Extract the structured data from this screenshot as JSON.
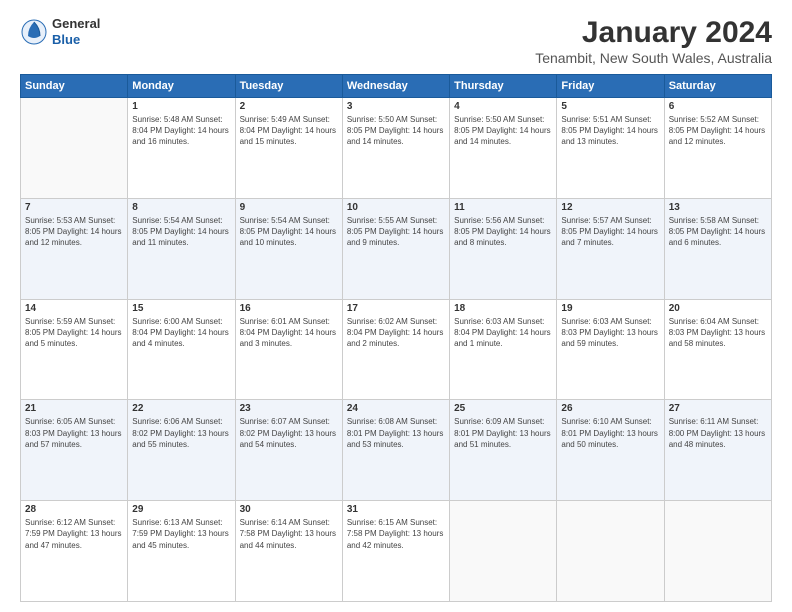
{
  "header": {
    "logo_general": "General",
    "logo_blue": "Blue",
    "title": "January 2024",
    "location": "Tenambit, New South Wales, Australia"
  },
  "weekdays": [
    "Sunday",
    "Monday",
    "Tuesday",
    "Wednesday",
    "Thursday",
    "Friday",
    "Saturday"
  ],
  "weeks": [
    [
      {
        "day": "",
        "info": ""
      },
      {
        "day": "1",
        "info": "Sunrise: 5:48 AM\nSunset: 8:04 PM\nDaylight: 14 hours\nand 16 minutes."
      },
      {
        "day": "2",
        "info": "Sunrise: 5:49 AM\nSunset: 8:04 PM\nDaylight: 14 hours\nand 15 minutes."
      },
      {
        "day": "3",
        "info": "Sunrise: 5:50 AM\nSunset: 8:05 PM\nDaylight: 14 hours\nand 14 minutes."
      },
      {
        "day": "4",
        "info": "Sunrise: 5:50 AM\nSunset: 8:05 PM\nDaylight: 14 hours\nand 14 minutes."
      },
      {
        "day": "5",
        "info": "Sunrise: 5:51 AM\nSunset: 8:05 PM\nDaylight: 14 hours\nand 13 minutes."
      },
      {
        "day": "6",
        "info": "Sunrise: 5:52 AM\nSunset: 8:05 PM\nDaylight: 14 hours\nand 12 minutes."
      }
    ],
    [
      {
        "day": "7",
        "info": "Sunrise: 5:53 AM\nSunset: 8:05 PM\nDaylight: 14 hours\nand 12 minutes."
      },
      {
        "day": "8",
        "info": "Sunrise: 5:54 AM\nSunset: 8:05 PM\nDaylight: 14 hours\nand 11 minutes."
      },
      {
        "day": "9",
        "info": "Sunrise: 5:54 AM\nSunset: 8:05 PM\nDaylight: 14 hours\nand 10 minutes."
      },
      {
        "day": "10",
        "info": "Sunrise: 5:55 AM\nSunset: 8:05 PM\nDaylight: 14 hours\nand 9 minutes."
      },
      {
        "day": "11",
        "info": "Sunrise: 5:56 AM\nSunset: 8:05 PM\nDaylight: 14 hours\nand 8 minutes."
      },
      {
        "day": "12",
        "info": "Sunrise: 5:57 AM\nSunset: 8:05 PM\nDaylight: 14 hours\nand 7 minutes."
      },
      {
        "day": "13",
        "info": "Sunrise: 5:58 AM\nSunset: 8:05 PM\nDaylight: 14 hours\nand 6 minutes."
      }
    ],
    [
      {
        "day": "14",
        "info": "Sunrise: 5:59 AM\nSunset: 8:05 PM\nDaylight: 14 hours\nand 5 minutes."
      },
      {
        "day": "15",
        "info": "Sunrise: 6:00 AM\nSunset: 8:04 PM\nDaylight: 14 hours\nand 4 minutes."
      },
      {
        "day": "16",
        "info": "Sunrise: 6:01 AM\nSunset: 8:04 PM\nDaylight: 14 hours\nand 3 minutes."
      },
      {
        "day": "17",
        "info": "Sunrise: 6:02 AM\nSunset: 8:04 PM\nDaylight: 14 hours\nand 2 minutes."
      },
      {
        "day": "18",
        "info": "Sunrise: 6:03 AM\nSunset: 8:04 PM\nDaylight: 14 hours\nand 1 minute."
      },
      {
        "day": "19",
        "info": "Sunrise: 6:03 AM\nSunset: 8:03 PM\nDaylight: 13 hours\nand 59 minutes."
      },
      {
        "day": "20",
        "info": "Sunrise: 6:04 AM\nSunset: 8:03 PM\nDaylight: 13 hours\nand 58 minutes."
      }
    ],
    [
      {
        "day": "21",
        "info": "Sunrise: 6:05 AM\nSunset: 8:03 PM\nDaylight: 13 hours\nand 57 minutes."
      },
      {
        "day": "22",
        "info": "Sunrise: 6:06 AM\nSunset: 8:02 PM\nDaylight: 13 hours\nand 55 minutes."
      },
      {
        "day": "23",
        "info": "Sunrise: 6:07 AM\nSunset: 8:02 PM\nDaylight: 13 hours\nand 54 minutes."
      },
      {
        "day": "24",
        "info": "Sunrise: 6:08 AM\nSunset: 8:01 PM\nDaylight: 13 hours\nand 53 minutes."
      },
      {
        "day": "25",
        "info": "Sunrise: 6:09 AM\nSunset: 8:01 PM\nDaylight: 13 hours\nand 51 minutes."
      },
      {
        "day": "26",
        "info": "Sunrise: 6:10 AM\nSunset: 8:01 PM\nDaylight: 13 hours\nand 50 minutes."
      },
      {
        "day": "27",
        "info": "Sunrise: 6:11 AM\nSunset: 8:00 PM\nDaylight: 13 hours\nand 48 minutes."
      }
    ],
    [
      {
        "day": "28",
        "info": "Sunrise: 6:12 AM\nSunset: 7:59 PM\nDaylight: 13 hours\nand 47 minutes."
      },
      {
        "day": "29",
        "info": "Sunrise: 6:13 AM\nSunset: 7:59 PM\nDaylight: 13 hours\nand 45 minutes."
      },
      {
        "day": "30",
        "info": "Sunrise: 6:14 AM\nSunset: 7:58 PM\nDaylight: 13 hours\nand 44 minutes."
      },
      {
        "day": "31",
        "info": "Sunrise: 6:15 AM\nSunset: 7:58 PM\nDaylight: 13 hours\nand 42 minutes."
      },
      {
        "day": "",
        "info": ""
      },
      {
        "day": "",
        "info": ""
      },
      {
        "day": "",
        "info": ""
      }
    ]
  ]
}
